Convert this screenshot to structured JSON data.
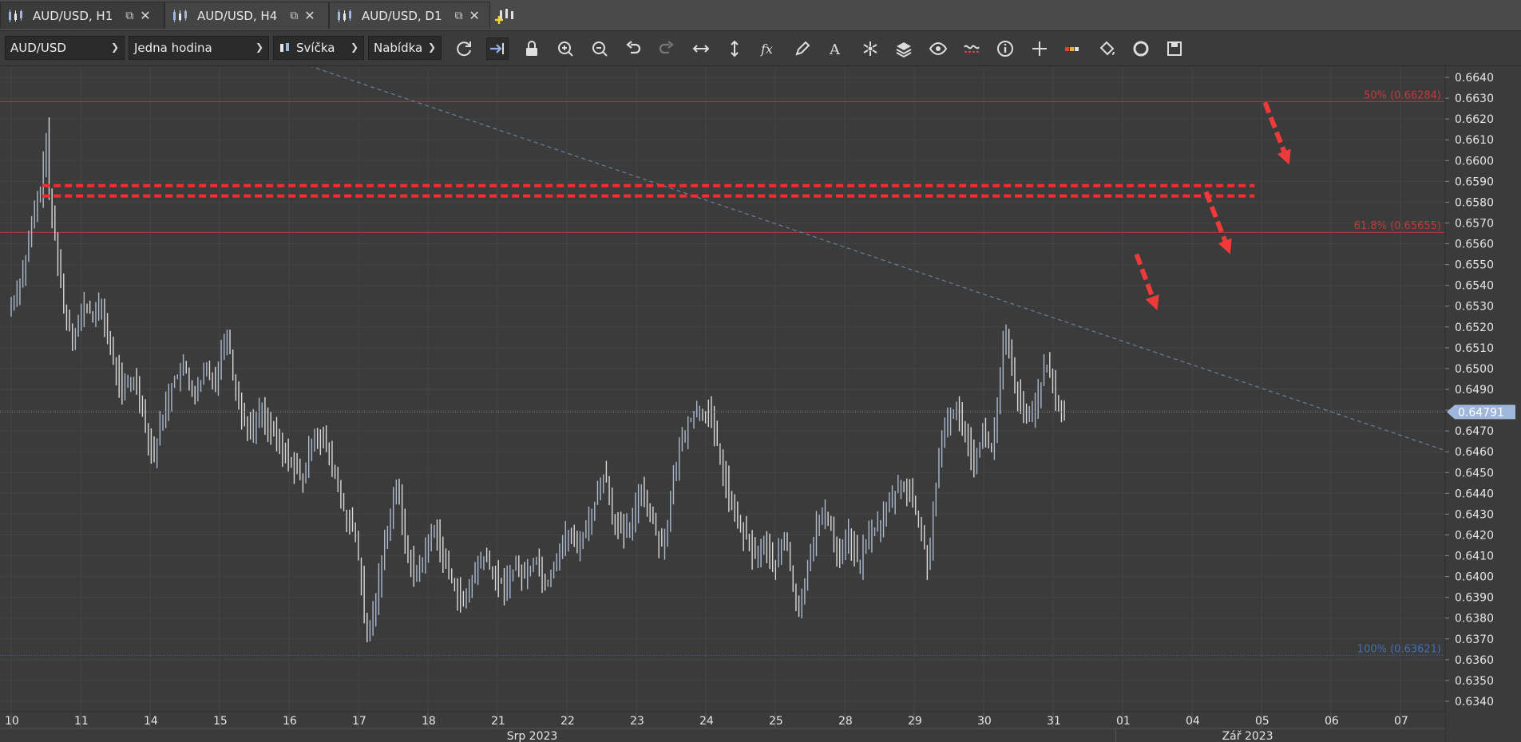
{
  "tabs": [
    {
      "label": "AUD/USD, H1",
      "active": true
    },
    {
      "label": "AUD/USD, H4",
      "active": false
    },
    {
      "label": "AUD/USD, D1",
      "active": false
    }
  ],
  "toolbar": {
    "instrument": "AUD/USD",
    "period": "Jedna hodina",
    "chart_type": "Svíčka",
    "price_side": "Nabídka",
    "icons": [
      "refresh-icon",
      "auto-shift-icon",
      "lock-icon",
      "zoom-in-icon",
      "zoom-out-icon",
      "undo-icon",
      "redo-icon",
      "horizontal-arrows-icon",
      "vertical-arrows-icon",
      "fx-icon",
      "pencil-icon",
      "text-icon",
      "star-icon",
      "layers-icon",
      "eye-icon",
      "indicator-icon",
      "info-icon",
      "crosshair-icon",
      "color-bar-icon",
      "paint-bucket-icon",
      "circle-arrows-icon",
      "save-icon"
    ]
  },
  "colors": {
    "background": "#3b3b3b",
    "bar": "#aab8cc",
    "fib_red": "#c23a3a",
    "fib_blue": "#3f6fb8",
    "arrow": "#f03a3a",
    "current_price_tag": "#9fb7da"
  },
  "chart_data": {
    "type": "ohlc",
    "symbol": "AUD/USD",
    "timeframe": "H1",
    "ylim": [
      0.6335,
      0.6645
    ],
    "y_ticks": [
      "0.6640",
      "0.6630",
      "0.6620",
      "0.6610",
      "0.6600",
      "0.6590",
      "0.6580",
      "0.6570",
      "0.6560",
      "0.6550",
      "0.6540",
      "0.6530",
      "0.6520",
      "0.6510",
      "0.6500",
      "0.6490",
      "0.6480",
      "0.6470",
      "0.6460",
      "0.6450",
      "0.6440",
      "0.6430",
      "0.6420",
      "0.6410",
      "0.6400",
      "0.6390",
      "0.6380",
      "0.6370",
      "0.6360",
      "0.6350",
      "0.6340"
    ],
    "x_ticks": [
      "10",
      "11",
      "14",
      "15",
      "16",
      "17",
      "18",
      "21",
      "22",
      "23",
      "24",
      "25",
      "28",
      "29",
      "30",
      "31",
      "01",
      "04",
      "05",
      "06",
      "07"
    ],
    "x_tick_slot": [
      0,
      1,
      2,
      3,
      4,
      5,
      6,
      7,
      8,
      9,
      10,
      11,
      12,
      13,
      14,
      15,
      16,
      17,
      18,
      19,
      20
    ],
    "months": [
      {
        "label": "Srp 2023",
        "slot": 7.5
      },
      {
        "label": "Zář 2023",
        "slot": 17.8
      }
    ],
    "month_divider_slot": 15.9,
    "last_data_slot": 15.2,
    "series": [
      {
        "price_path": [
          [
            0.0,
            0.653
          ],
          [
            0.2,
            0.655
          ],
          [
            0.3,
            0.657
          ],
          [
            0.45,
            0.659
          ],
          [
            0.5,
            0.6615
          ],
          [
            0.55,
            0.658
          ],
          [
            0.65,
            0.656
          ],
          [
            0.75,
            0.653
          ],
          [
            0.9,
            0.6515
          ],
          [
            1.05,
            0.653
          ],
          [
            1.2,
            0.6525
          ],
          [
            1.3,
            0.653
          ],
          [
            1.45,
            0.6505
          ],
          [
            1.6,
            0.649
          ],
          [
            1.8,
            0.6495
          ],
          [
            1.95,
            0.647
          ],
          [
            2.05,
            0.6458
          ],
          [
            2.2,
            0.648
          ],
          [
            2.35,
            0.6495
          ],
          [
            2.5,
            0.65
          ],
          [
            2.65,
            0.6485
          ],
          [
            2.8,
            0.65
          ],
          [
            2.95,
            0.6495
          ],
          [
            3.1,
            0.652
          ],
          [
            3.2,
            0.6495
          ],
          [
            3.3,
            0.648
          ],
          [
            3.45,
            0.647
          ],
          [
            3.6,
            0.648
          ],
          [
            3.75,
            0.647
          ],
          [
            3.9,
            0.646
          ],
          [
            4.05,
            0.6455
          ],
          [
            4.2,
            0.6445
          ],
          [
            4.35,
            0.647
          ],
          [
            4.5,
            0.6465
          ],
          [
            4.65,
            0.645
          ],
          [
            4.8,
            0.643
          ],
          [
            4.95,
            0.642
          ],
          [
            5.05,
            0.6395
          ],
          [
            5.1,
            0.6368
          ],
          [
            5.2,
            0.638
          ],
          [
            5.3,
            0.64
          ],
          [
            5.45,
            0.643
          ],
          [
            5.55,
            0.6445
          ],
          [
            5.65,
            0.642
          ],
          [
            5.8,
            0.64
          ],
          [
            5.95,
            0.641
          ],
          [
            6.1,
            0.6425
          ],
          [
            6.25,
            0.6405
          ],
          [
            6.4,
            0.6395
          ],
          [
            6.5,
            0.6385
          ],
          [
            6.65,
            0.64
          ],
          [
            6.8,
            0.641
          ],
          [
            6.95,
            0.64
          ],
          [
            7.1,
            0.6395
          ],
          [
            7.25,
            0.6405
          ],
          [
            7.4,
            0.64
          ],
          [
            7.55,
            0.641
          ],
          [
            7.7,
            0.6395
          ],
          [
            7.85,
            0.641
          ],
          [
            8.0,
            0.642
          ],
          [
            8.15,
            0.6415
          ],
          [
            8.3,
            0.6425
          ],
          [
            8.45,
            0.644
          ],
          [
            8.55,
            0.6452
          ],
          [
            8.65,
            0.643
          ],
          [
            8.8,
            0.642
          ],
          [
            8.95,
            0.6425
          ],
          [
            9.05,
            0.6445
          ],
          [
            9.2,
            0.643
          ],
          [
            9.35,
            0.6415
          ],
          [
            9.45,
            0.6425
          ],
          [
            9.55,
            0.645
          ],
          [
            9.65,
            0.6465
          ],
          [
            9.75,
            0.6475
          ],
          [
            9.9,
            0.648
          ],
          [
            10.05,
            0.6478
          ],
          [
            10.15,
            0.6465
          ],
          [
            10.25,
            0.645
          ],
          [
            10.4,
            0.643
          ],
          [
            10.55,
            0.642
          ],
          [
            10.7,
            0.641
          ],
          [
            10.85,
            0.6415
          ],
          [
            11.0,
            0.6405
          ],
          [
            11.15,
            0.642
          ],
          [
            11.25,
            0.6395
          ],
          [
            11.35,
            0.638
          ],
          [
            11.45,
            0.6405
          ],
          [
            11.6,
            0.6425
          ],
          [
            11.75,
            0.643
          ],
          [
            11.9,
            0.641
          ],
          [
            12.05,
            0.642
          ],
          [
            12.2,
            0.6405
          ],
          [
            12.35,
            0.642
          ],
          [
            12.5,
            0.6425
          ],
          [
            12.65,
            0.6435
          ],
          [
            12.8,
            0.6445
          ],
          [
            12.95,
            0.644
          ],
          [
            13.1,
            0.642
          ],
          [
            13.2,
            0.6405
          ],
          [
            13.3,
            0.644
          ],
          [
            13.45,
            0.6475
          ],
          [
            13.6,
            0.648
          ],
          [
            13.75,
            0.647
          ],
          [
            13.85,
            0.6455
          ],
          [
            14.0,
            0.647
          ],
          [
            14.1,
            0.646
          ],
          [
            14.2,
            0.648
          ],
          [
            14.3,
            0.6518
          ],
          [
            14.4,
            0.65
          ],
          [
            14.5,
            0.6485
          ],
          [
            14.6,
            0.6475
          ],
          [
            14.7,
            0.648
          ],
          [
            14.8,
            0.649
          ],
          [
            14.9,
            0.6502
          ],
          [
            15.0,
            0.649
          ],
          [
            15.1,
            0.648
          ],
          [
            15.2,
            0.6479
          ]
        ]
      }
    ],
    "fib_levels": [
      {
        "label": "50% (0.66284)",
        "value": 0.66284,
        "color": "red"
      },
      {
        "label": "61.8% (0.65655)",
        "value": 0.65655,
        "color": "red"
      },
      {
        "label": "100% (0.63621)",
        "value": 0.63621,
        "color": "blue"
      }
    ],
    "resistance_zone": {
      "upper": 0.6588,
      "lower": 0.6583,
      "from_slot": 0.45,
      "to_slot": 17.9
    },
    "trendline": {
      "start": [
        3.9,
        0.665
      ],
      "end": [
        20.7,
        0.646
      ]
    },
    "current_price": {
      "label": "0.64791",
      "value": 0.64791
    },
    "arrows": [
      {
        "from": [
          16.2,
          0.6555
        ],
        "to": [
          16.5,
          0.6528
        ]
      },
      {
        "from": [
          17.2,
          0.6585
        ],
        "to": [
          17.55,
          0.6555
        ]
      },
      {
        "from": [
          18.05,
          0.6628
        ],
        "to": [
          18.4,
          0.6598
        ]
      }
    ]
  }
}
